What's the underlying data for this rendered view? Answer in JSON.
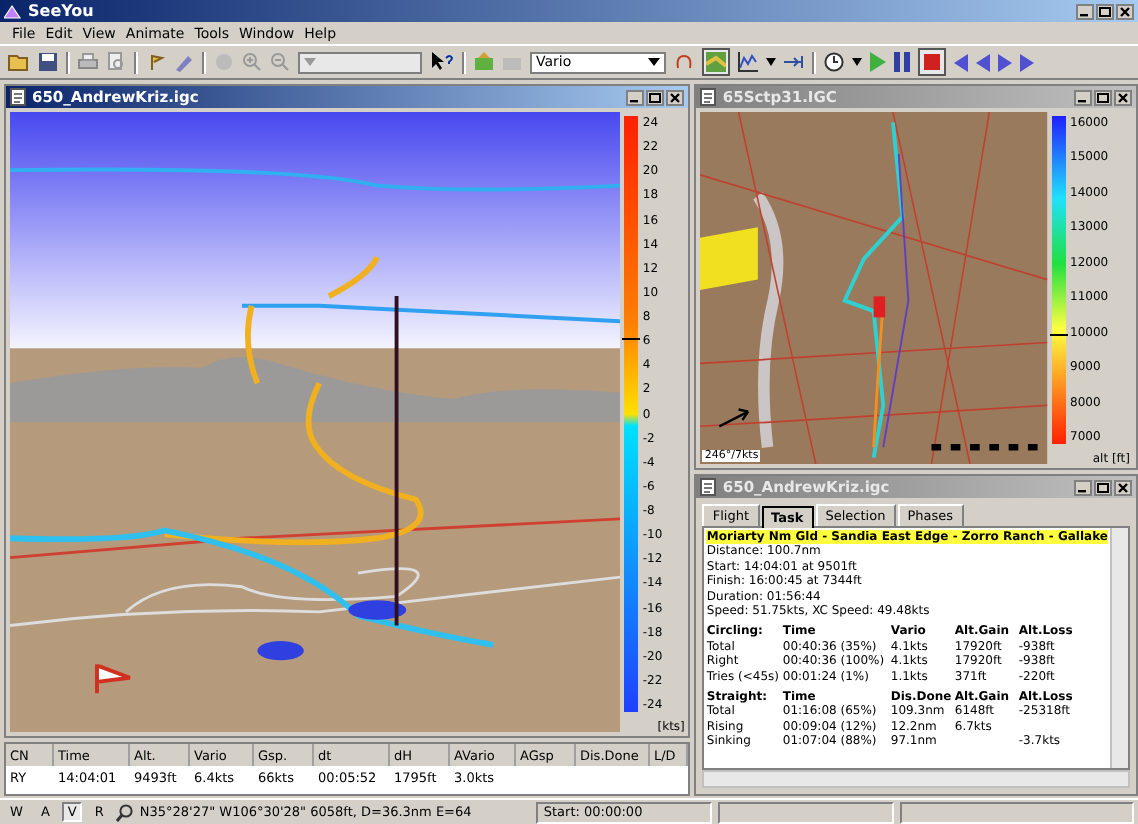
{
  "window": {
    "title": "SeeYou"
  },
  "menu": [
    "File",
    "Edit",
    "View",
    "Animate",
    "Tools",
    "Window",
    "Help"
  ],
  "toolbar": {
    "variable_dropdown": {
      "value": "Vario"
    },
    "playback": {
      "playing": false
    }
  },
  "view_3d": {
    "title": "650_AndrewKriz.igc",
    "scale_ticks": [
      "24",
      "22",
      "20",
      "18",
      "16",
      "14",
      "12",
      "10",
      "8",
      "6",
      "4",
      "2",
      "0",
      "-2",
      "-4",
      "-6",
      "-8",
      "-10",
      "-12",
      "-14",
      "-16",
      "-18",
      "-20",
      "-22",
      "-24"
    ],
    "scale_unit": "[kts]",
    "level": 0.625
  },
  "map": {
    "title": "65Sctp31.IGC",
    "scale_ticks": [
      "16000",
      "15000",
      "14000",
      "13000",
      "12000",
      "11000",
      "10000",
      "9000",
      "8000",
      "7000"
    ],
    "scale_unit": "alt [ft]",
    "wind": "246°/7kts",
    "level": 0.33
  },
  "stats": {
    "title": "650_AndrewKriz.igc",
    "tabs": [
      {
        "label": "Flight",
        "selected": false
      },
      {
        "label": "Task",
        "selected": true
      },
      {
        "label": "Selection",
        "selected": false
      },
      {
        "label": "Phases",
        "selected": false
      }
    ],
    "task_name": "Moriarty Nm Gld - Sandia East Edge - Zorro Ranch - Gallake",
    "summary": [
      "Distance: 100.7nm",
      "Start:  14:04:01 at 9501ft",
      "Finish:  16:00:45 at 7344ft",
      "Duration: 01:56:44",
      "Speed: 51.75kts,  XC Speed: 49.48kts"
    ],
    "tables": [
      {
        "header": [
          "Circling:",
          "Time",
          "Vario",
          "Alt.Gain",
          "Alt.Loss"
        ],
        "rows": [
          [
            "Total",
            "00:40:36 (35%)",
            "4.1kts",
            "17920ft",
            "-938ft"
          ],
          [
            "Right",
            "00:40:36 (100%)",
            "4.1kts",
            "17920ft",
            "-938ft"
          ],
          [
            "Tries (<45s)",
            "00:01:24 (1%)",
            "1.1kts",
            "371ft",
            "-220ft"
          ]
        ]
      },
      {
        "header": [
          "Straight:",
          "Time",
          "Dis.Done",
          "Alt.Gain",
          "Alt.Loss"
        ],
        "rows": [
          [
            "Total",
            "01:16:08 (65%)",
            "109.3nm",
            "6148ft",
            "-25318ft"
          ],
          [
            "Rising",
            "00:09:04 (12%)",
            "12.2nm",
            "6.7kts",
            ""
          ],
          [
            "Sinking",
            "01:07:04 (88%)",
            "97.1nm",
            "",
            "-3.7kts"
          ]
        ]
      }
    ]
  },
  "fix_table": {
    "columns": [
      "CN",
      "Time",
      "Alt.",
      "Vario",
      "Gsp.",
      "dt",
      "dH",
      "AVario",
      "AGsp",
      "Dis.Done",
      "L/D"
    ],
    "rows": [
      [
        "RY",
        "14:04:01",
        "9493ft",
        "6.4kts",
        "66kts",
        "00:05:52",
        "1795ft",
        "3.0kts",
        "",
        "",
        ""
      ]
    ]
  },
  "status_bar": {
    "toggles": [
      {
        "label": "W",
        "selected": false
      },
      {
        "label": "A",
        "selected": false
      },
      {
        "label": "V",
        "selected": true
      },
      {
        "label": "R",
        "selected": false
      }
    ],
    "position": "N35°28'27\"  W106°30'28\" 6058ft, D=36.3nm E=64",
    "start": "Start: 00:00:00"
  }
}
